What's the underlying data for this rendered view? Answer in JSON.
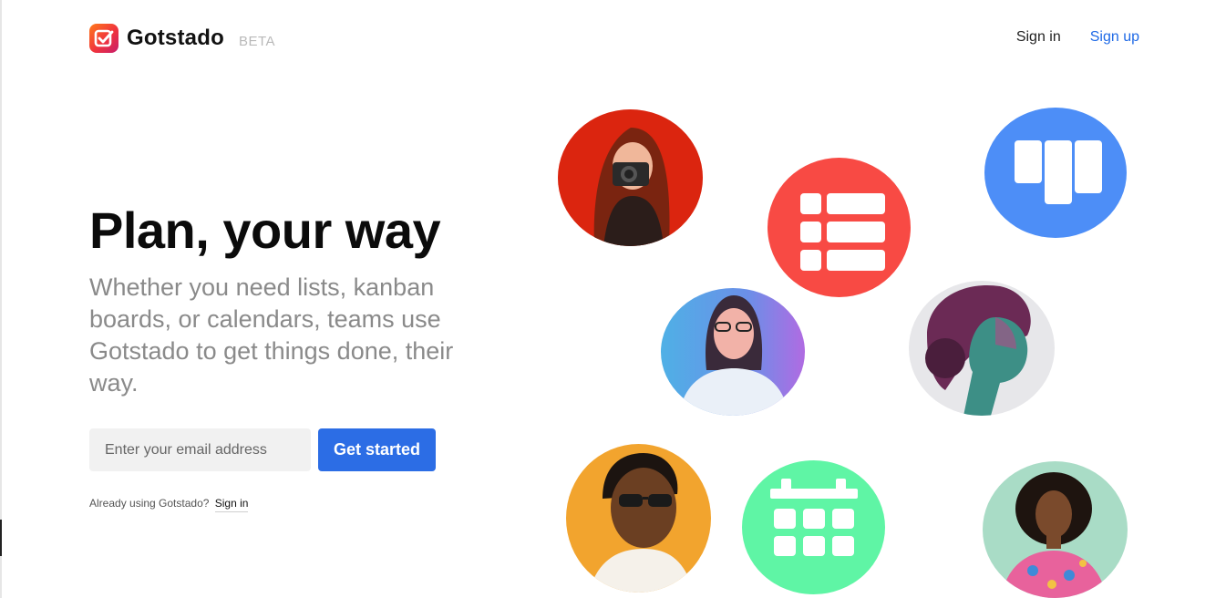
{
  "header": {
    "brand": "Gotstado",
    "badge": "BETA",
    "nav": {
      "sign_in": "Sign in",
      "sign_up": "Sign up"
    }
  },
  "hero": {
    "title": "Plan, your way",
    "subtitle": "Whether you need lists, kanban boards, or calendars, teams use Gotstado to get things done, their way."
  },
  "form": {
    "email_placeholder": "Enter your email address",
    "cta": "Get started"
  },
  "footer_note": {
    "text": "Already using Gotstado?",
    "link": "Sign in"
  },
  "colors": {
    "list_circle": "#f84a44",
    "kanban_circle": "#4d8ef7",
    "calendar_circle": "#5ff5a5",
    "primary": "#2c6de5",
    "sign_up_link": "#1f6ae6"
  },
  "illustrations": [
    {
      "kind": "photo",
      "subject": "woman with camera"
    },
    {
      "kind": "icon",
      "icon": "list-icon"
    },
    {
      "kind": "icon",
      "icon": "kanban-icon"
    },
    {
      "kind": "photo",
      "subject": "smiling woman with glasses"
    },
    {
      "kind": "photo",
      "subject": "woman in profile"
    },
    {
      "kind": "photo",
      "subject": "man with sunglasses"
    },
    {
      "kind": "icon",
      "icon": "calendar-icon"
    },
    {
      "kind": "photo",
      "subject": "woman with curly hair"
    }
  ]
}
